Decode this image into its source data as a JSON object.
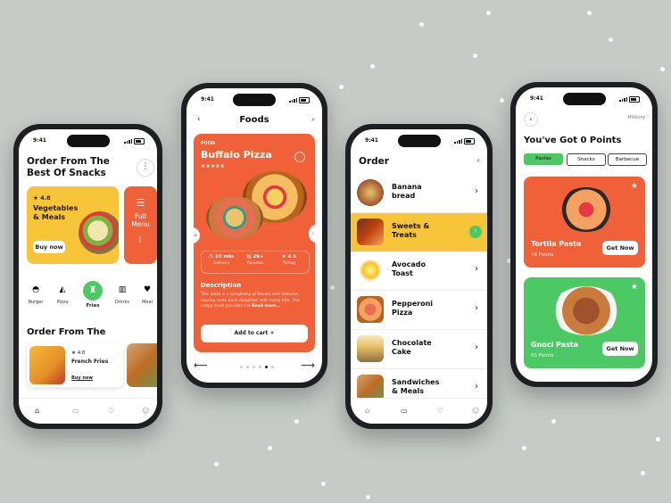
{
  "status_time": "9:41",
  "colors": {
    "accent_orange": "#f0613a",
    "accent_green": "#4cc864",
    "accent_yellow": "#f8c539",
    "background": "#c6cbc7"
  },
  "phone1": {
    "title_line1": "Order From The",
    "title_line2": "Best Of Snacks",
    "banner": {
      "rating": "4.8",
      "title_line1": "Vegetables",
      "title_line2": "& Meals",
      "buy_label": "Buy now",
      "side_line1": "Full",
      "side_line2": "Menu"
    },
    "categories": [
      {
        "label": "Burger",
        "icon": "burger-icon"
      },
      {
        "label": "Pizza",
        "icon": "pizza-icon"
      },
      {
        "label": "Fries",
        "icon": "fries-icon"
      },
      {
        "label": "Drinks",
        "icon": "drink-icon"
      },
      {
        "label": "Meal",
        "icon": "heart-icon"
      }
    ],
    "section_title": "Order From The",
    "card": {
      "rating": "4.8",
      "name": "French Fries",
      "buy_label": "Buy now"
    }
  },
  "phone2": {
    "header_title": "Foods",
    "logo_text": "FOOD",
    "product_title": "Buffalo Pizza",
    "stats": [
      {
        "value": "10 min",
        "label": "Delivery"
      },
      {
        "value": "2k+",
        "label": "Reviews"
      },
      {
        "value": "4.6",
        "label": "Rating"
      }
    ],
    "description_title": "Description",
    "description_text": "This pizza is a symphony of flavors and textures, leaving taste buds delighted with every bite. The crispy crust provides the",
    "read_more": "Read more...",
    "cart_label": "Add to cart",
    "cart_icon": "+"
  },
  "phone3": {
    "header_title": "Order",
    "items": [
      {
        "line1": "Banana",
        "line2": "bread"
      },
      {
        "line1": "Sweets &",
        "line2": "Treats"
      },
      {
        "line1": "Avocado",
        "line2": "Toast"
      },
      {
        "line1": "Pepperoni",
        "line2": "Pizza"
      },
      {
        "line1": "Chocolate",
        "line2": "Cake"
      },
      {
        "line1": "Sandwiches",
        "line2": "& Meals"
      }
    ]
  },
  "phone4": {
    "history_label": "History",
    "title": "You've Got 0 Points",
    "tabs": [
      "Pastas",
      "Snacks",
      "Barbecue"
    ],
    "cards": [
      {
        "name": "Tortila Pasta",
        "points": "78 Points",
        "action": "Get Now"
      },
      {
        "name": "Gnoci Pasta",
        "points": "65 Points",
        "action": "Get Now"
      }
    ]
  }
}
